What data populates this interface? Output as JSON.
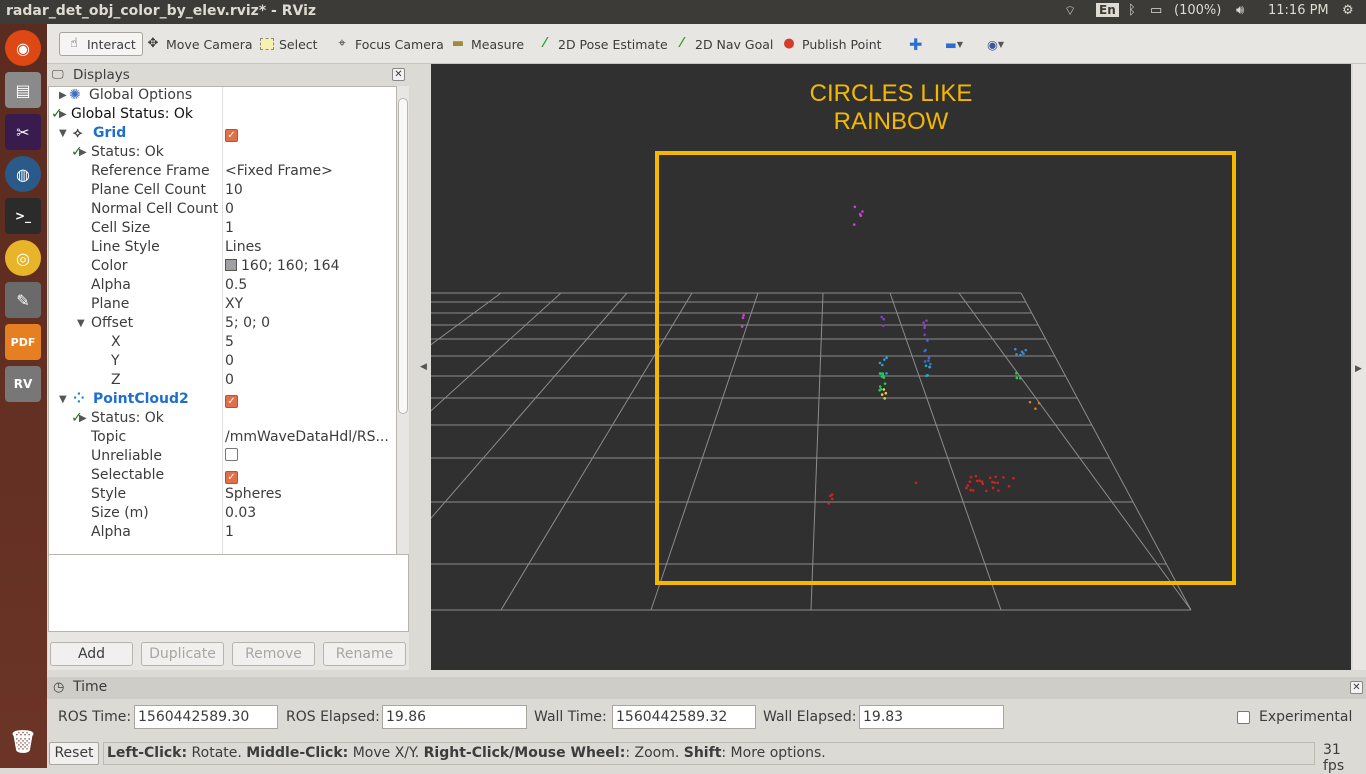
{
  "window_title": "radar_det_obj_color_by_elev.rviz* - RViz",
  "indicators": {
    "lang": "En",
    "battery": "(100%)",
    "clock": "11:16 PM"
  },
  "toolbar": {
    "interact": "Interact",
    "move_camera": "Move Camera",
    "select": "Select",
    "focus_camera": "Focus Camera",
    "measure": "Measure",
    "pose_estimate": "2D Pose Estimate",
    "nav_goal": "2D Nav Goal",
    "publish_point": "Publish Point"
  },
  "displays": {
    "title": "Displays",
    "rows": [
      {
        "label": "Global Options",
        "value": ""
      },
      {
        "label": "Global Status: Ok",
        "value": ""
      },
      {
        "label": "Grid",
        "value": ""
      },
      {
        "label": "Status: Ok",
        "value": ""
      },
      {
        "label": "Reference Frame",
        "value": "<Fixed Frame>"
      },
      {
        "label": "Plane Cell Count",
        "value": "10"
      },
      {
        "label": "Normal Cell Count",
        "value": "0"
      },
      {
        "label": "Cell Size",
        "value": "1"
      },
      {
        "label": "Line Style",
        "value": "Lines"
      },
      {
        "label": "Color",
        "value": "160; 160; 164"
      },
      {
        "label": "Alpha",
        "value": "0.5"
      },
      {
        "label": "Plane",
        "value": "XY"
      },
      {
        "label": "Offset",
        "value": "5; 0; 0"
      },
      {
        "label": "X",
        "value": "5"
      },
      {
        "label": "Y",
        "value": "0"
      },
      {
        "label": "Z",
        "value": "0"
      },
      {
        "label": "PointCloud2",
        "value": ""
      },
      {
        "label": "Status: Ok",
        "value": ""
      },
      {
        "label": "Topic",
        "value": "/mmWaveDataHdl/RS..."
      },
      {
        "label": "Unreliable",
        "value": ""
      },
      {
        "label": "Selectable",
        "value": ""
      },
      {
        "label": "Style",
        "value": "Spheres"
      },
      {
        "label": "Size (m)",
        "value": "0.03"
      },
      {
        "label": "Alpha",
        "value": "1"
      }
    ],
    "buttons": {
      "add": "Add",
      "duplicate": "Duplicate",
      "remove": "Remove",
      "rename": "Rename"
    }
  },
  "view": {
    "annotation": "CIRCLES LIKE RAINBOW",
    "annotation_color": "#f5b800"
  },
  "time": {
    "title": "Time",
    "ros_time_label": "ROS Time:",
    "ros_time": "1560442589.30",
    "ros_elapsed_label": "ROS Elapsed:",
    "ros_elapsed": "19.86",
    "wall_time_label": "Wall Time:",
    "wall_time": "1560442589.32",
    "wall_elapsed_label": "Wall Elapsed:",
    "wall_elapsed": "19.83",
    "experimental": "Experimental"
  },
  "status": {
    "reset": "Reset",
    "hint_b1": "Left-Click:",
    "hint_t1": " Rotate. ",
    "hint_b2": "Middle-Click:",
    "hint_t2": " Move X/Y. ",
    "hint_b3": "Right-Click/Mouse Wheel:",
    "hint_t3": ": Zoom. ",
    "hint_b4": "Shift",
    "hint_t4": ": More options.",
    "fps": "31 fps"
  }
}
